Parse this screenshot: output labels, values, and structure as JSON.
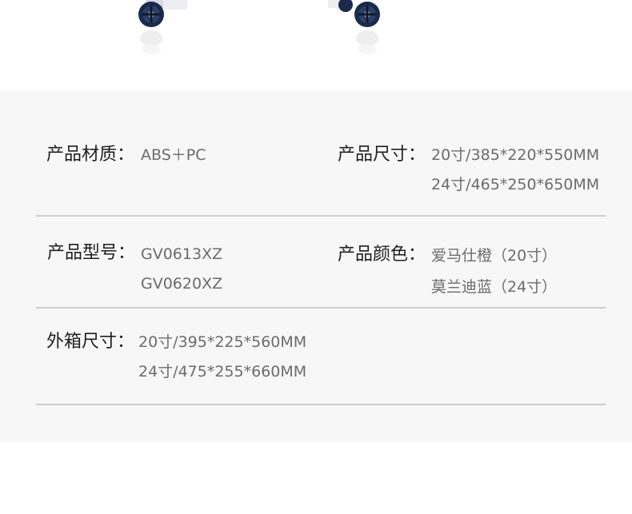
{
  "specs": {
    "material": {
      "label": "产品材质：",
      "lines": [
        "ABS＋PC"
      ]
    },
    "size": {
      "label": "产品尺寸：",
      "lines": [
        "20寸/385*220*550MM",
        "24寸/465*250*650MM"
      ]
    },
    "model": {
      "label": "产品型号：",
      "lines": [
        "GV0613XZ",
        "GV0620XZ"
      ]
    },
    "color": {
      "label": "产品颜色：",
      "lines": [
        "爱马仕橙（20寸）",
        "莫兰迪蓝（24寸）"
      ]
    },
    "carton": {
      "label": "外箱尺寸：",
      "lines": [
        "20寸/395*225*560MM",
        "24寸/475*255*660MM"
      ]
    }
  },
  "colors": {
    "panel_bg": "#f7f7f7",
    "label": "#1f1f1f",
    "value": "#6b6b6b",
    "divider": "#cfcfcf",
    "wheel": "#1b2a4a"
  }
}
